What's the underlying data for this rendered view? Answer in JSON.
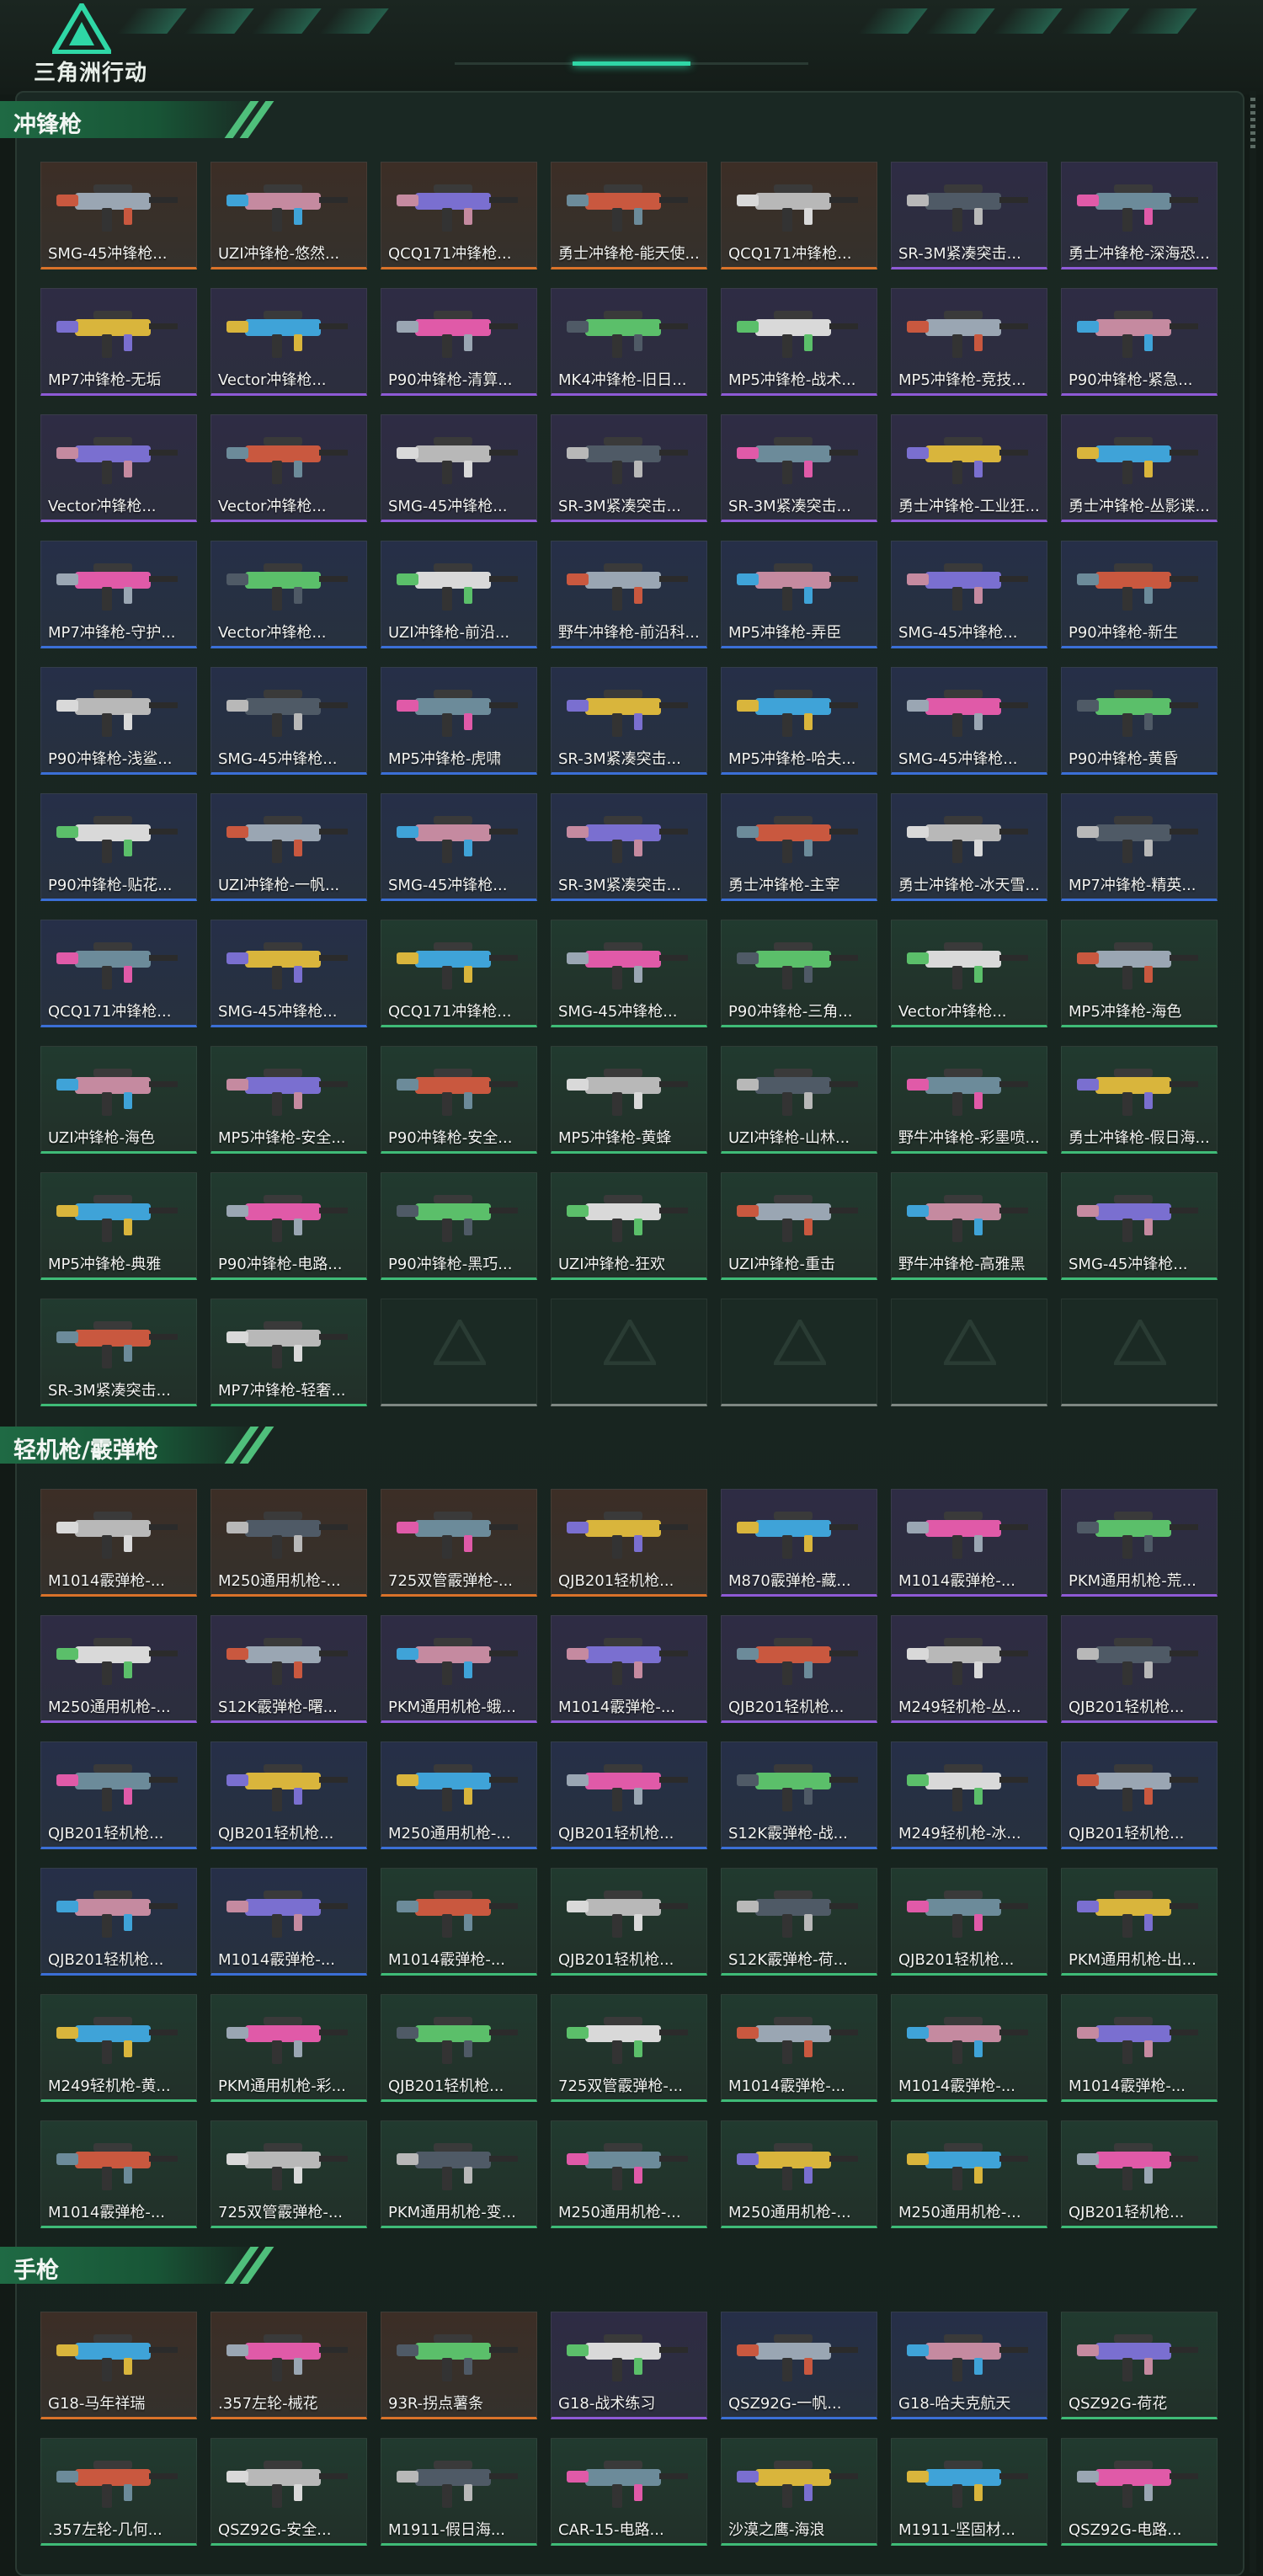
{
  "app": {
    "logo_text": "三角洲行动"
  },
  "colors": {
    "orange": "#d9722a",
    "purple": "#8e5ad6",
    "blue": "#3b6fd6",
    "green": "#3fbb77",
    "accent": "#2fd7a6"
  },
  "sections": [
    {
      "title": "冲锋枪",
      "items": [
        {
          "label": "SMG-45冲锋枪...",
          "rarity": "orange"
        },
        {
          "label": "UZI冲锋枪-悠然...",
          "rarity": "orange"
        },
        {
          "label": "QCQ171冲锋枪...",
          "rarity": "orange"
        },
        {
          "label": "勇士冲锋枪-能天使...",
          "rarity": "orange"
        },
        {
          "label": "QCQ171冲锋枪...",
          "rarity": "orange"
        },
        {
          "label": "SR-3M紧凑突击...",
          "rarity": "purple"
        },
        {
          "label": "勇士冲锋枪-深海恐...",
          "rarity": "purple"
        },
        {
          "label": "MP7冲锋枪-无垢",
          "rarity": "purple"
        },
        {
          "label": "Vector冲锋枪...",
          "rarity": "purple"
        },
        {
          "label": "P90冲锋枪-清算...",
          "rarity": "purple"
        },
        {
          "label": "MK4冲锋枪-旧日...",
          "rarity": "purple"
        },
        {
          "label": "MP5冲锋枪-战术...",
          "rarity": "purple"
        },
        {
          "label": "MP5冲锋枪-竞技...",
          "rarity": "purple"
        },
        {
          "label": "P90冲锋枪-紧急...",
          "rarity": "purple"
        },
        {
          "label": "Vector冲锋枪...",
          "rarity": "purple"
        },
        {
          "label": "Vector冲锋枪...",
          "rarity": "purple"
        },
        {
          "label": "SMG-45冲锋枪...",
          "rarity": "purple"
        },
        {
          "label": "SR-3M紧凑突击...",
          "rarity": "purple"
        },
        {
          "label": "SR-3M紧凑突击...",
          "rarity": "purple"
        },
        {
          "label": "勇士冲锋枪-工业狂...",
          "rarity": "purple"
        },
        {
          "label": "勇士冲锋枪-丛影谍...",
          "rarity": "purple"
        },
        {
          "label": "MP7冲锋枪-守护...",
          "rarity": "blue"
        },
        {
          "label": "Vector冲锋枪...",
          "rarity": "blue"
        },
        {
          "label": "UZI冲锋枪-前沿...",
          "rarity": "blue"
        },
        {
          "label": "野牛冲锋枪-前沿科...",
          "rarity": "blue"
        },
        {
          "label": "MP5冲锋枪-弄臣",
          "rarity": "blue"
        },
        {
          "label": "SMG-45冲锋枪...",
          "rarity": "blue"
        },
        {
          "label": "P90冲锋枪-新生",
          "rarity": "blue"
        },
        {
          "label": "P90冲锋枪-浅鲨...",
          "rarity": "blue"
        },
        {
          "label": "SMG-45冲锋枪...",
          "rarity": "blue"
        },
        {
          "label": "MP5冲锋枪-虎啸",
          "rarity": "blue"
        },
        {
          "label": "SR-3M紧凑突击...",
          "rarity": "blue"
        },
        {
          "label": "MP5冲锋枪-哈夫...",
          "rarity": "blue"
        },
        {
          "label": "SMG-45冲锋枪...",
          "rarity": "blue"
        },
        {
          "label": "P90冲锋枪-黄昏",
          "rarity": "blue"
        },
        {
          "label": "P90冲锋枪-贴花...",
          "rarity": "blue"
        },
        {
          "label": "UZI冲锋枪-一帆...",
          "rarity": "blue"
        },
        {
          "label": "SMG-45冲锋枪...",
          "rarity": "blue"
        },
        {
          "label": "SR-3M紧凑突击...",
          "rarity": "blue"
        },
        {
          "label": "勇士冲锋枪-主宰",
          "rarity": "blue"
        },
        {
          "label": "勇士冲锋枪-冰天雪...",
          "rarity": "blue"
        },
        {
          "label": "MP7冲锋枪-精英...",
          "rarity": "blue"
        },
        {
          "label": "QCQ171冲锋枪...",
          "rarity": "blue"
        },
        {
          "label": "SMG-45冲锋枪...",
          "rarity": "blue"
        },
        {
          "label": "QCQ171冲锋枪...",
          "rarity": "green"
        },
        {
          "label": "SMG-45冲锋枪...",
          "rarity": "green"
        },
        {
          "label": "P90冲锋枪-三角...",
          "rarity": "green"
        },
        {
          "label": "Vector冲锋枪...",
          "rarity": "green"
        },
        {
          "label": "MP5冲锋枪-海色",
          "rarity": "green"
        },
        {
          "label": "UZI冲锋枪-海色",
          "rarity": "green"
        },
        {
          "label": "MP5冲锋枪-安全...",
          "rarity": "green"
        },
        {
          "label": "P90冲锋枪-安全...",
          "rarity": "green"
        },
        {
          "label": "MP5冲锋枪-黄蜂",
          "rarity": "green"
        },
        {
          "label": "UZI冲锋枪-山林...",
          "rarity": "green"
        },
        {
          "label": "野牛冲锋枪-彩墨喷...",
          "rarity": "green"
        },
        {
          "label": "勇士冲锋枪-假日海...",
          "rarity": "green"
        },
        {
          "label": "MP5冲锋枪-典雅",
          "rarity": "green"
        },
        {
          "label": "P90冲锋枪-电路...",
          "rarity": "green"
        },
        {
          "label": "P90冲锋枪-黑巧...",
          "rarity": "green"
        },
        {
          "label": "UZI冲锋枪-狂欢",
          "rarity": "green"
        },
        {
          "label": "UZI冲锋枪-重击",
          "rarity": "green"
        },
        {
          "label": "野牛冲锋枪-高雅黑",
          "rarity": "green"
        },
        {
          "label": "SMG-45冲锋枪...",
          "rarity": "green"
        },
        {
          "label": "SR-3M紧凑突击...",
          "rarity": "green"
        },
        {
          "label": "MP7冲锋枪-轻奢...",
          "rarity": "green"
        }
      ],
      "empty_slots": 5
    },
    {
      "title": "轻机枪/霰弹枪",
      "items": [
        {
          "label": "M1014霰弹枪-...",
          "rarity": "orange"
        },
        {
          "label": "M250通用机枪-...",
          "rarity": "orange"
        },
        {
          "label": "725双管霰弹枪-...",
          "rarity": "orange"
        },
        {
          "label": "QJB201轻机枪...",
          "rarity": "orange"
        },
        {
          "label": "M870霰弹枪-藏...",
          "rarity": "purple"
        },
        {
          "label": "M1014霰弹枪-...",
          "rarity": "purple"
        },
        {
          "label": "PKM通用机枪-荒...",
          "rarity": "purple"
        },
        {
          "label": "M250通用机枪-...",
          "rarity": "purple"
        },
        {
          "label": "S12K霰弹枪-曙...",
          "rarity": "purple"
        },
        {
          "label": "PKM通用机枪-蛾...",
          "rarity": "purple"
        },
        {
          "label": "M1014霰弹枪-...",
          "rarity": "purple"
        },
        {
          "label": "QJB201轻机枪...",
          "rarity": "purple"
        },
        {
          "label": "M249轻机枪-丛...",
          "rarity": "purple"
        },
        {
          "label": "QJB201轻机枪...",
          "rarity": "purple"
        },
        {
          "label": "QJB201轻机枪...",
          "rarity": "blue"
        },
        {
          "label": "QJB201轻机枪...",
          "rarity": "blue"
        },
        {
          "label": "M250通用机枪-...",
          "rarity": "blue"
        },
        {
          "label": "QJB201轻机枪...",
          "rarity": "blue"
        },
        {
          "label": "S12K霰弹枪-战...",
          "rarity": "blue"
        },
        {
          "label": "M249轻机枪-冰...",
          "rarity": "blue"
        },
        {
          "label": "QJB201轻机枪...",
          "rarity": "blue"
        },
        {
          "label": "QJB201轻机枪...",
          "rarity": "blue"
        },
        {
          "label": "M1014霰弹枪-...",
          "rarity": "blue"
        },
        {
          "label": "M1014霰弹枪-...",
          "rarity": "green"
        },
        {
          "label": "QJB201轻机枪...",
          "rarity": "green"
        },
        {
          "label": "S12K霰弹枪-荷...",
          "rarity": "green"
        },
        {
          "label": "QJB201轻机枪...",
          "rarity": "green"
        },
        {
          "label": "PKM通用机枪-出...",
          "rarity": "green"
        },
        {
          "label": "M249轻机枪-黄...",
          "rarity": "green"
        },
        {
          "label": "PKM通用机枪-彩...",
          "rarity": "green"
        },
        {
          "label": "QJB201轻机枪...",
          "rarity": "green"
        },
        {
          "label": "725双管霰弹枪-...",
          "rarity": "green"
        },
        {
          "label": "M1014霰弹枪-...",
          "rarity": "green"
        },
        {
          "label": "M1014霰弹枪-...",
          "rarity": "green"
        },
        {
          "label": "M1014霰弹枪-...",
          "rarity": "green"
        },
        {
          "label": "M1014霰弹枪-...",
          "rarity": "green"
        },
        {
          "label": "725双管霰弹枪-...",
          "rarity": "green"
        },
        {
          "label": "PKM通用机枪-变...",
          "rarity": "green"
        },
        {
          "label": "M250通用机枪-...",
          "rarity": "green"
        },
        {
          "label": "M250通用机枪-...",
          "rarity": "green"
        },
        {
          "label": "M250通用机枪-...",
          "rarity": "green"
        },
        {
          "label": "QJB201轻机枪...",
          "rarity": "green"
        }
      ],
      "empty_slots": 0
    },
    {
      "title": "手枪",
      "items": [
        {
          "label": "G18-马年祥瑞",
          "rarity": "orange"
        },
        {
          "label": ".357左轮-械花",
          "rarity": "orange"
        },
        {
          "label": "93R-拐点薯条",
          "rarity": "orange"
        },
        {
          "label": "G18-战术练习",
          "rarity": "purple"
        },
        {
          "label": "QSZ92G-一帆...",
          "rarity": "blue"
        },
        {
          "label": "G18-哈夫克航天",
          "rarity": "blue"
        },
        {
          "label": "QSZ92G-荷花",
          "rarity": "green"
        },
        {
          "label": ".357左轮-几何...",
          "rarity": "green"
        },
        {
          "label": "QSZ92G-安全...",
          "rarity": "green"
        },
        {
          "label": "M1911-假日海...",
          "rarity": "green"
        },
        {
          "label": "CAR-15-电路...",
          "rarity": "green"
        },
        {
          "label": "沙漠之鹰-海浪",
          "rarity": "green"
        },
        {
          "label": "M1911-坚固材...",
          "rarity": "green"
        },
        {
          "label": "QSZ92G-电路...",
          "rarity": "green"
        }
      ],
      "empty_slots": 0
    }
  ]
}
